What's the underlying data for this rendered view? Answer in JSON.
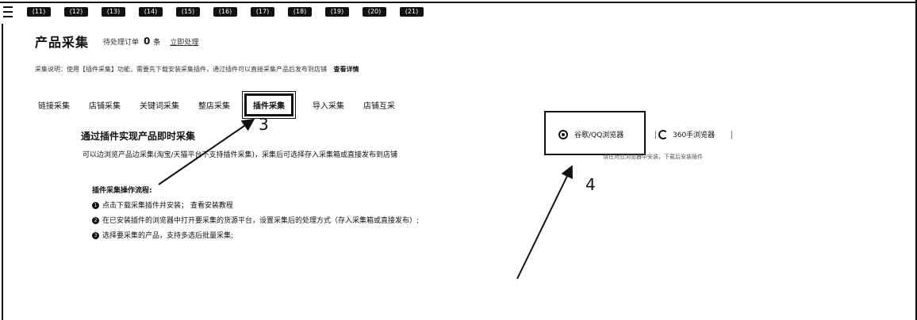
{
  "top_nav": [
    "(11)",
    "(12)",
    "(13)",
    "(14)",
    "(15)",
    "(16)",
    "(17)",
    "(18)",
    "(19)",
    "(20)",
    "(21)"
  ],
  "header": {
    "title": "产品采集",
    "pending_label": "待处理订单",
    "pending_count": "0",
    "pending_unit": "条",
    "view_link": "立即处理"
  },
  "notice": {
    "text": "采集说明：使用【插件采集】功能，需要先下载安装采集插件，通过插件可以直接采集产品后发布到店铺",
    "more": "查看详情"
  },
  "tabs": [
    "链接采集",
    "店铺采集",
    "关键词采集",
    "整店采集",
    "插件采集",
    "导入采集",
    "店铺互采"
  ],
  "active_tab_index": 4,
  "plugin_section": {
    "title": "通过插件实现产品即时采集",
    "description": "可以边浏览产品边采集(淘宝/天猫平台不支持插件采集)，采集后可选择存入采集箱或直接发布到店铺",
    "steps_title": "插件采集操作流程:",
    "steps": [
      "点击下载采集插件并安装；  查看安装教程",
      "在已安装插件的浏览器中打开要采集的货源平台，设置采集后的处理方式（存入采集箱或直接发布）;",
      "选择要采集的产品，支持多选后批量采集;"
    ]
  },
  "browsers": {
    "chrome": "谷歌/QQ浏览器",
    "browser_360": "360手浏览器",
    "hint": "请在对应浏览器中安装，下载后安装插件"
  },
  "annotations": {
    "label_3": "3",
    "label_4": "4"
  }
}
